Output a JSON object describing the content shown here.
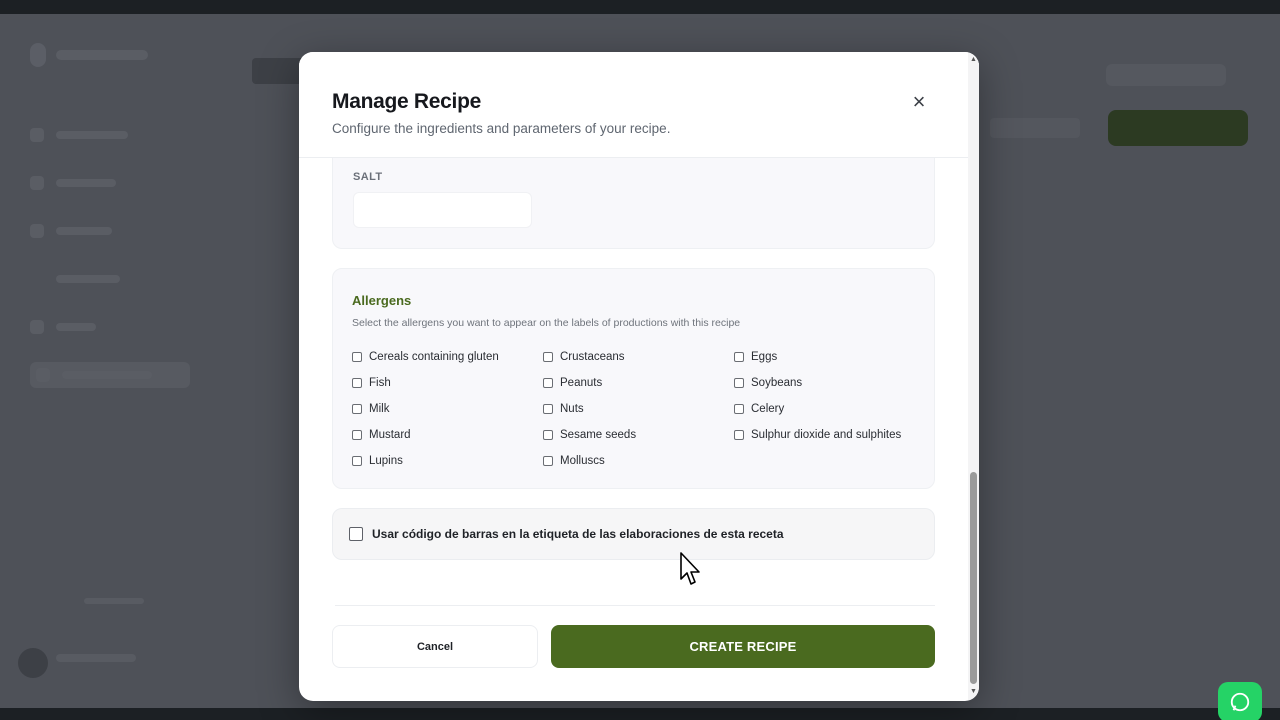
{
  "modal": {
    "title": "Manage Recipe",
    "subtitle": "Configure the ingredients and parameters of your recipe.",
    "close_icon": "×"
  },
  "salt": {
    "label": "SALT",
    "value": ""
  },
  "allergens": {
    "title": "Allergens",
    "description": "Select the allergens you want to appear on the labels of productions with this recipe",
    "items": [
      {
        "label": "Cereals containing gluten",
        "checked": false
      },
      {
        "label": "Crustaceans",
        "checked": false
      },
      {
        "label": "Eggs",
        "checked": false
      },
      {
        "label": "Fish",
        "checked": false
      },
      {
        "label": "Peanuts",
        "checked": false
      },
      {
        "label": "Soybeans",
        "checked": false
      },
      {
        "label": "Milk",
        "checked": false
      },
      {
        "label": "Nuts",
        "checked": false
      },
      {
        "label": "Celery",
        "checked": false
      },
      {
        "label": "Mustard",
        "checked": false
      },
      {
        "label": "Sesame seeds",
        "checked": false
      },
      {
        "label": "Sulphur dioxide and sulphites",
        "checked": false
      },
      {
        "label": "Lupins",
        "checked": false
      },
      {
        "label": "Molluscs",
        "checked": false
      }
    ]
  },
  "barcode": {
    "label": "Usar código de barras en la etiqueta de las elaboraciones de esta receta",
    "checked": false
  },
  "footer": {
    "cancel_label": "Cancel",
    "create_label": "CREATE RECIPE"
  },
  "colors": {
    "accent": "#4a6a1f",
    "whatsapp": "#25d366"
  },
  "icons": {
    "close": "close-icon",
    "whatsapp": "whatsapp-icon",
    "cursor": "mouse-pointer-icon"
  }
}
